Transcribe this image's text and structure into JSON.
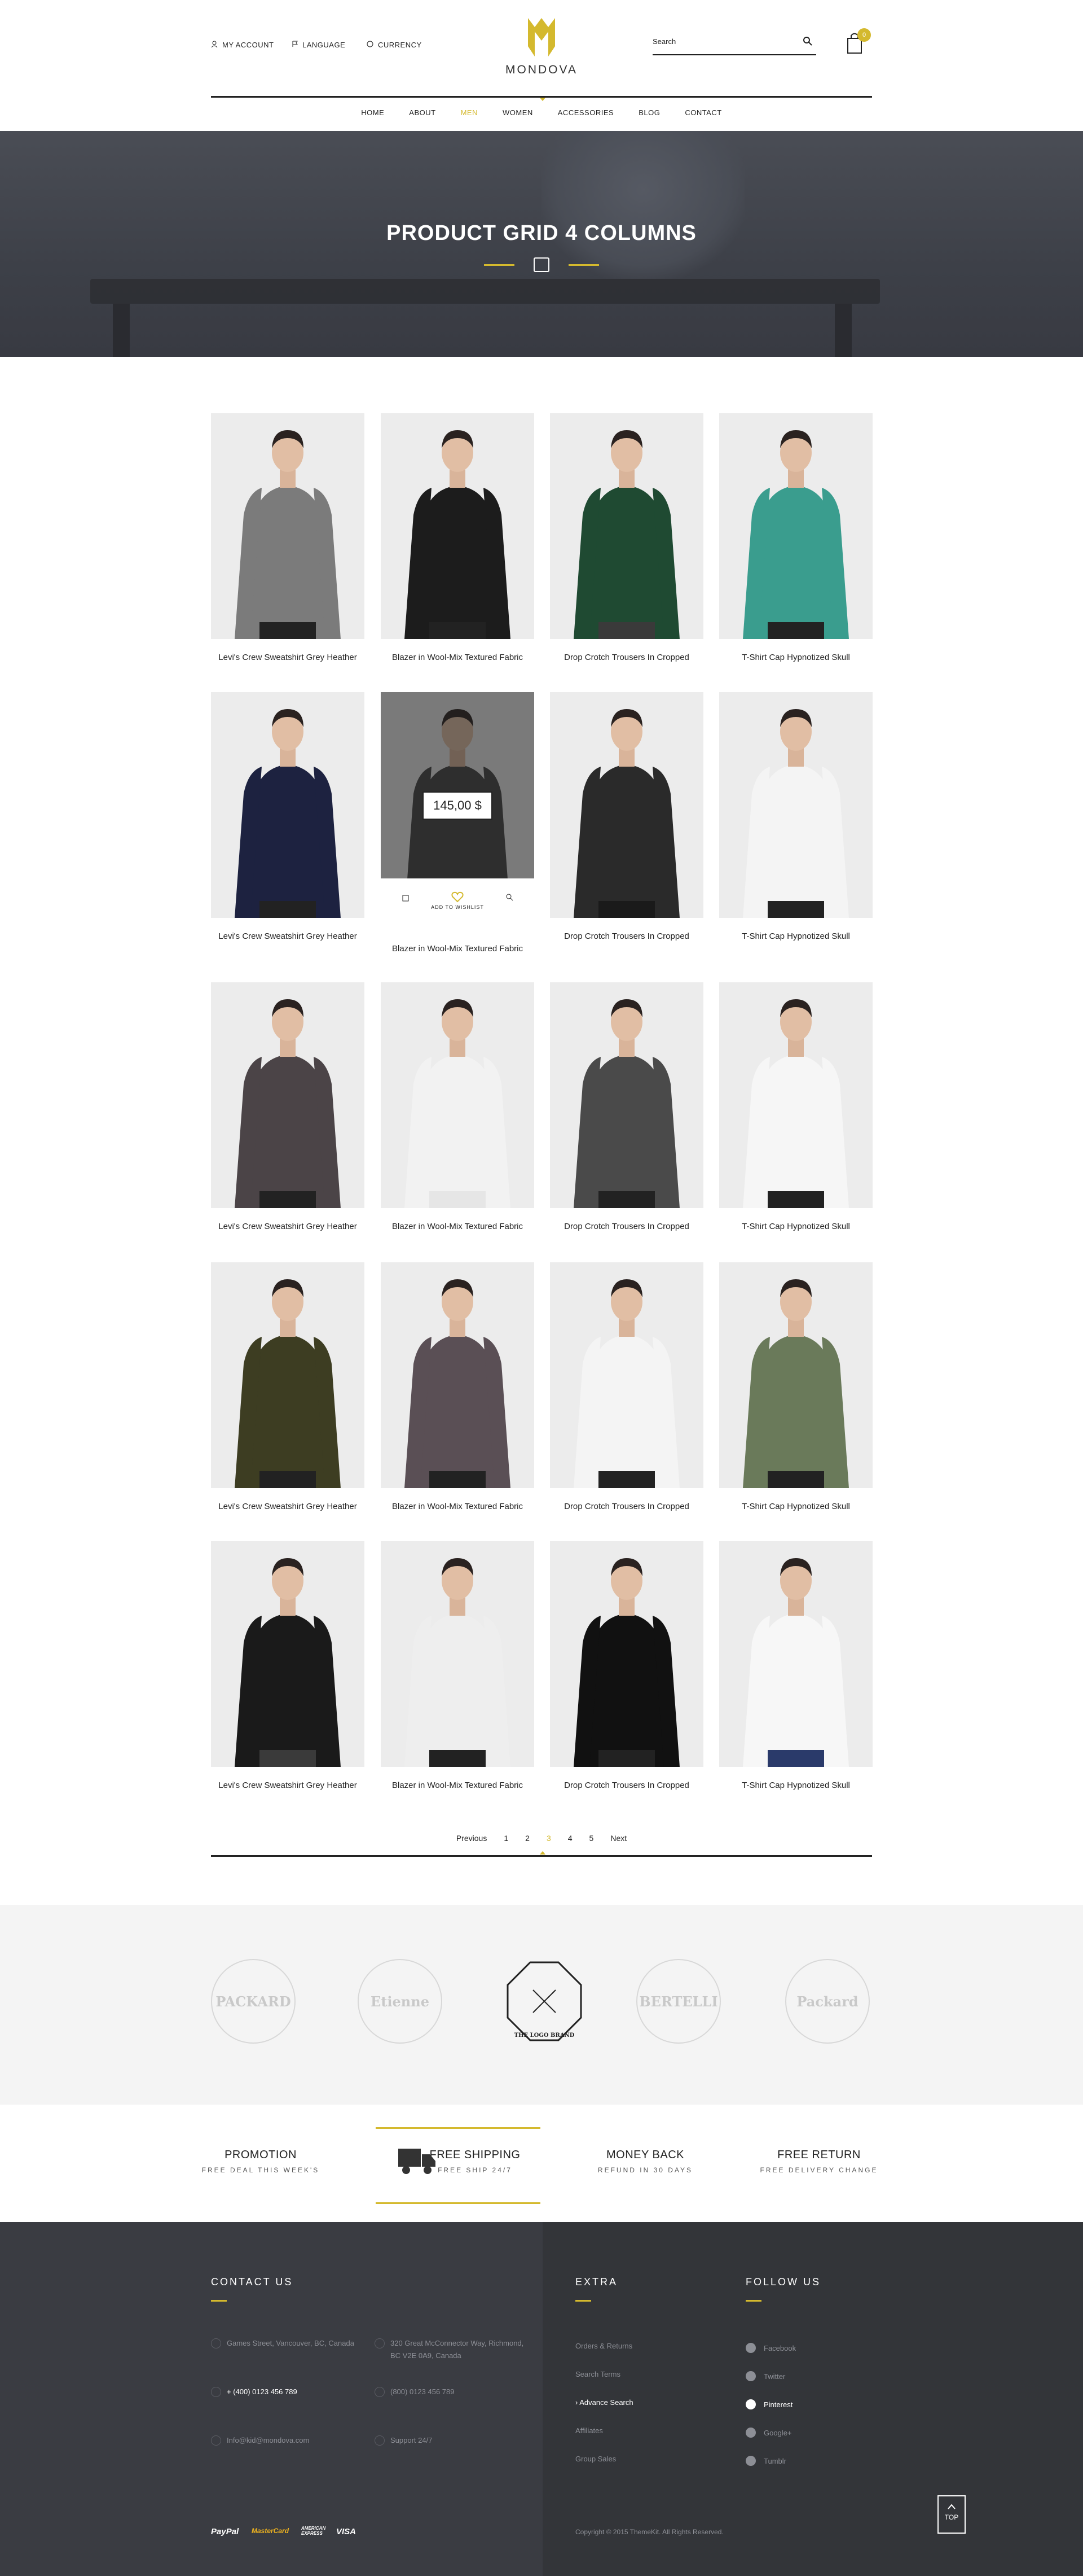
{
  "header": {
    "account": "MY ACCOUNT",
    "language": "LANGUAGE",
    "currency": "CURRENCY",
    "logo_text": "MONDOVA",
    "search_placeholder": "Search",
    "cart_count": "0"
  },
  "nav": [
    "HOME",
    "ABOUT",
    "MEN",
    "WOMEN",
    "ACCESSORIES",
    "BLOG",
    "CONTACT"
  ],
  "nav_active": "MEN",
  "banner": {
    "title": "PRODUCT GRID 4 COLUMNS"
  },
  "products": [
    {
      "name": "Levi's Crew Sweatshirt Grey Heather",
      "shirt": "#7b7b7b",
      "pants": "#222"
    },
    {
      "name": "Blazer in Wool-Mix Textured Fabric",
      "shirt": "#1c1c1c",
      "pants": "#222"
    },
    {
      "name": "Drop Crotch Trousers In Cropped",
      "shirt": "#1f4a32",
      "pants": "#3a3a3a"
    },
    {
      "name": "T-Shirt Cap Hypnotized Skull",
      "shirt": "#3a9d8e",
      "pants": "#222"
    },
    {
      "name": "Levi's Crew Sweatshirt Grey Heather",
      "shirt": "#1d2240",
      "pants": "#222"
    },
    {
      "name": "Blazer in Wool-Mix Textured Fabric",
      "shirt": "#444",
      "pants": "#222"
    },
    {
      "name": "Drop Crotch Trousers In Cropped",
      "shirt": "#2a2a2a",
      "pants": "#1a1a1a"
    },
    {
      "name": "T-Shirt Cap Hypnotized Skull",
      "shirt": "#f4f4f4",
      "pants": "#222"
    },
    {
      "name": "Levi's Crew Sweatshirt Grey Heather",
      "shirt": "#4b4447",
      "pants": "#222"
    },
    {
      "name": "Blazer in Wool-Mix Textured Fabric",
      "shirt": "#f2f2f2",
      "pants": "#e6e6e6"
    },
    {
      "name": "Drop Crotch Trousers In Cropped",
      "shirt": "#4a4a4a",
      "pants": "#222"
    },
    {
      "name": "T-Shirt Cap Hypnotized Skull",
      "shirt": "#f6f6f6",
      "pants": "#222"
    },
    {
      "name": "Levi's Crew Sweatshirt Grey Heather",
      "shirt": "#3d3d22",
      "pants": "#222"
    },
    {
      "name": "Blazer in Wool-Mix Textured Fabric",
      "shirt": "#5a4f55",
      "pants": "#222"
    },
    {
      "name": "Drop Crotch Trousers In Cropped",
      "shirt": "#f4f4f4",
      "pants": "#222"
    },
    {
      "name": "T-Shirt Cap Hypnotized Skull",
      "shirt": "#6a7a5a",
      "pants": "#222"
    },
    {
      "name": "Levi's Crew Sweatshirt Grey Heather",
      "shirt": "#1a1a1a",
      "pants": "#3a3a3a"
    },
    {
      "name": "Blazer in Wool-Mix Textured Fabric",
      "shirt": "#eeeeee",
      "pants": "#222"
    },
    {
      "name": "Drop Crotch Trousers In Cropped",
      "shirt": "#111111",
      "pants": "#222"
    },
    {
      "name": "T-Shirt Cap Hypnotized Skull",
      "shirt": "#f7f7f7",
      "pants": "#2a3a6a"
    }
  ],
  "hover_product": {
    "price": "145,00 $",
    "wishlist": "ADD TO WISHLIST"
  },
  "pagination": {
    "prev": "Previous",
    "pages": [
      "1",
      "2",
      "3",
      "4",
      "5"
    ],
    "current": "3",
    "next": "Next"
  },
  "brands": [
    "PACKARD",
    "Etienne",
    "THE LOGO BRAND",
    "BERTELLI",
    "Packard"
  ],
  "services": [
    {
      "title": "PROMOTION",
      "sub": "FREE DEAL THIS WEEK'S"
    },
    {
      "title": "FREE SHIPPING",
      "sub": "FREE SHIP 24/7"
    },
    {
      "title": "MONEY BACK",
      "sub": "REFUND IN 30 DAYS"
    },
    {
      "title": "FREE RETURN",
      "sub": "FREE DELIVERY CHANGE"
    }
  ],
  "footer": {
    "contact_title": "CONTACT US",
    "addr1": "Games Street, Vancouver, BC, Canada",
    "addr2": "320 Great McConnector Way, Richmond, BC V2E 0A9, Canada",
    "phone1": "+ (400) 0123 456 789",
    "phone2": "(800) 0123 456 789",
    "email": "Info@kid@mondova.com",
    "support": "Support 24/7",
    "extra_title": "EXTRA",
    "extra_links": [
      "Orders & Returns",
      "Search Terms",
      "Advance Search",
      "Affiliates",
      "Group Sales"
    ],
    "extra_active": "Advance Search",
    "follow_title": "FOLLOW US",
    "social": [
      "Facebook",
      "Twitter",
      "Pinterest",
      "Google+",
      "Tumblr"
    ],
    "social_active": "Pinterest",
    "payments": [
      "PayPal",
      "MasterCard",
      "AMERICAN EXPRESS",
      "VISA"
    ],
    "copyright": "Copyright © 2015 ThemeKit. All Rights Reserved.",
    "top": "TOP"
  },
  "colors": {
    "accent": "#d4b92e",
    "dark": "#3a3c42"
  }
}
